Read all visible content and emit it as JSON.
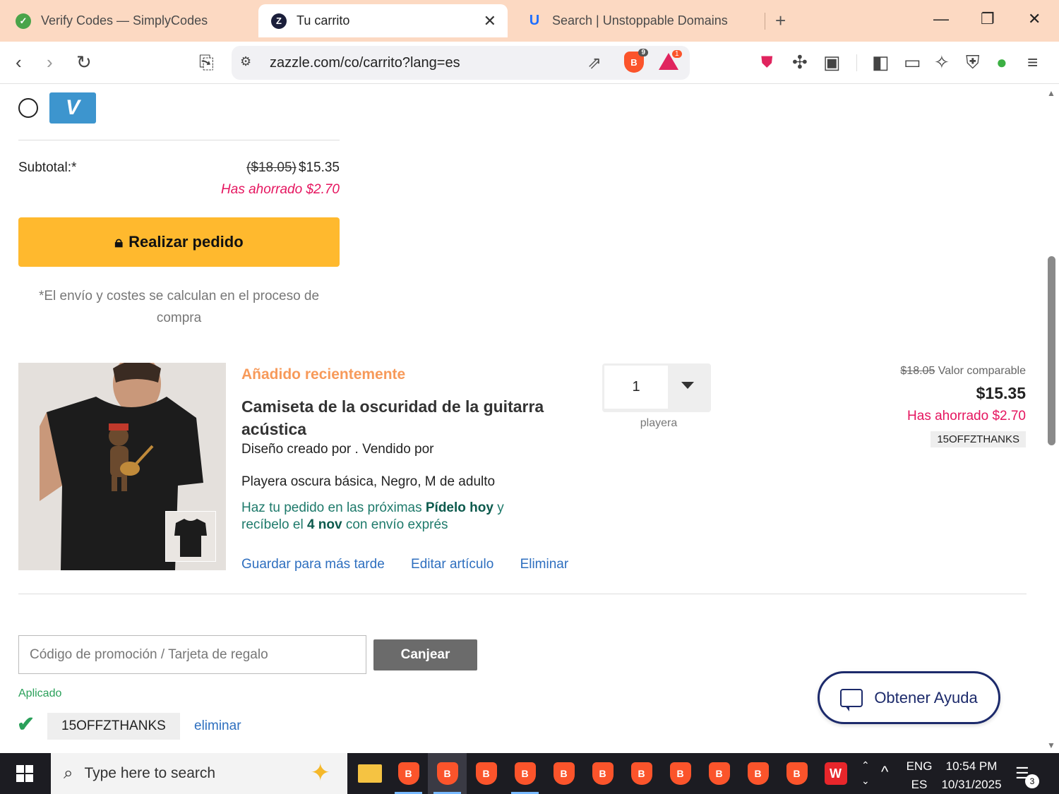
{
  "browser": {
    "tabs": [
      {
        "title": "Verify Codes — SimplyCodes",
        "favicon": "simplycodes-icon"
      },
      {
        "title": "Tu carrito",
        "favicon": "zazzle-icon",
        "active": true
      },
      {
        "title": "Search | Unstoppable Domains",
        "favicon": "unstoppable-domains-icon"
      }
    ],
    "url": "zazzle.com/co/carrito?lang=es",
    "shield_badge": "9",
    "rewards_badge": "1"
  },
  "payment": {
    "method_logo": "V"
  },
  "summary": {
    "subtotal_label": "Subtotal:*",
    "original_price": "($18.05)",
    "current_price": "$15.35",
    "saved_text": "Has ahorrado $2.70",
    "order_button": "Realizar pedido",
    "shipping_note": "*El envío y costes se calculan en el proceso de compra"
  },
  "item": {
    "recent_label": "Añadido recientemente",
    "title": "Camiseta de la oscuridad de la guitarra acústica",
    "designer_text": "Diseño creado por . Vendido por",
    "variant": "Playera oscura básica, Negro, M de adulto",
    "delivery_prefix": "Haz tu pedido en las próximas ",
    "delivery_bold1": "Pídelo hoy",
    "delivery_mid": " y recíbelo el ",
    "delivery_bold2": "4 nov",
    "delivery_suffix": " con envío exprés",
    "link_save": "Guardar para más tarde",
    "link_edit": "Editar artículo",
    "link_remove": "Eliminar",
    "quantity": "1",
    "quantity_unit": "playera",
    "compare_price": "$18.05",
    "compare_label": " Valor comparable",
    "price": "$15.35",
    "saved_text": "Has ahorrado $2.70",
    "code": "15OFFZTHANKS"
  },
  "promo": {
    "placeholder": "Código de promoción / Tarjeta de regalo",
    "redeem_button": "Canjear",
    "applied_label": "Aplicado",
    "applied_code": "15OFFZTHANKS",
    "remove_link": "eliminar"
  },
  "help_button": "Obtener Ayuda",
  "taskbar": {
    "search_placeholder": "Type here to search",
    "lang_top": "ENG",
    "lang_bottom": "ES",
    "time": "10:54 PM",
    "date": "10/31/2025",
    "notification_count": "3"
  },
  "colors": {
    "accent_button": "#ffb92e",
    "sale_red": "#e5155f",
    "link_blue": "#2e6fbf",
    "recent_orange": "#f79a5a",
    "delivery_green": "#1e7a6b",
    "help_navy": "#1c2a6b"
  }
}
